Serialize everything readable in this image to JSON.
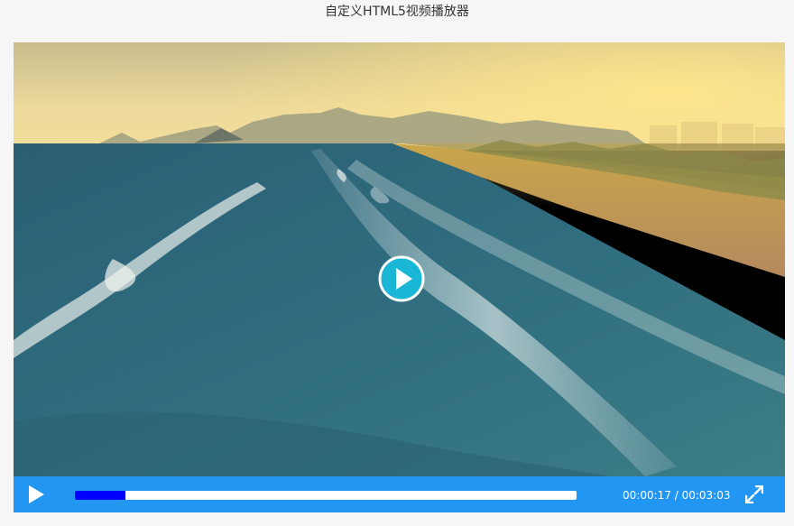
{
  "page": {
    "title": "自定义HTML5视频播放器"
  },
  "player": {
    "current_time": "00:00:17",
    "separator": " / ",
    "duration": "00:03:03",
    "progress_fraction": 0.1,
    "colors": {
      "control_bar": "#2196f3",
      "progress_track": "#ffffff",
      "progress_fill": "#0000ff",
      "big_play_button": "#1ab6d6"
    },
    "icons": {
      "big_play": "play-circle-icon",
      "play": "play-icon",
      "fullscreen": "fullscreen-icon"
    }
  }
}
